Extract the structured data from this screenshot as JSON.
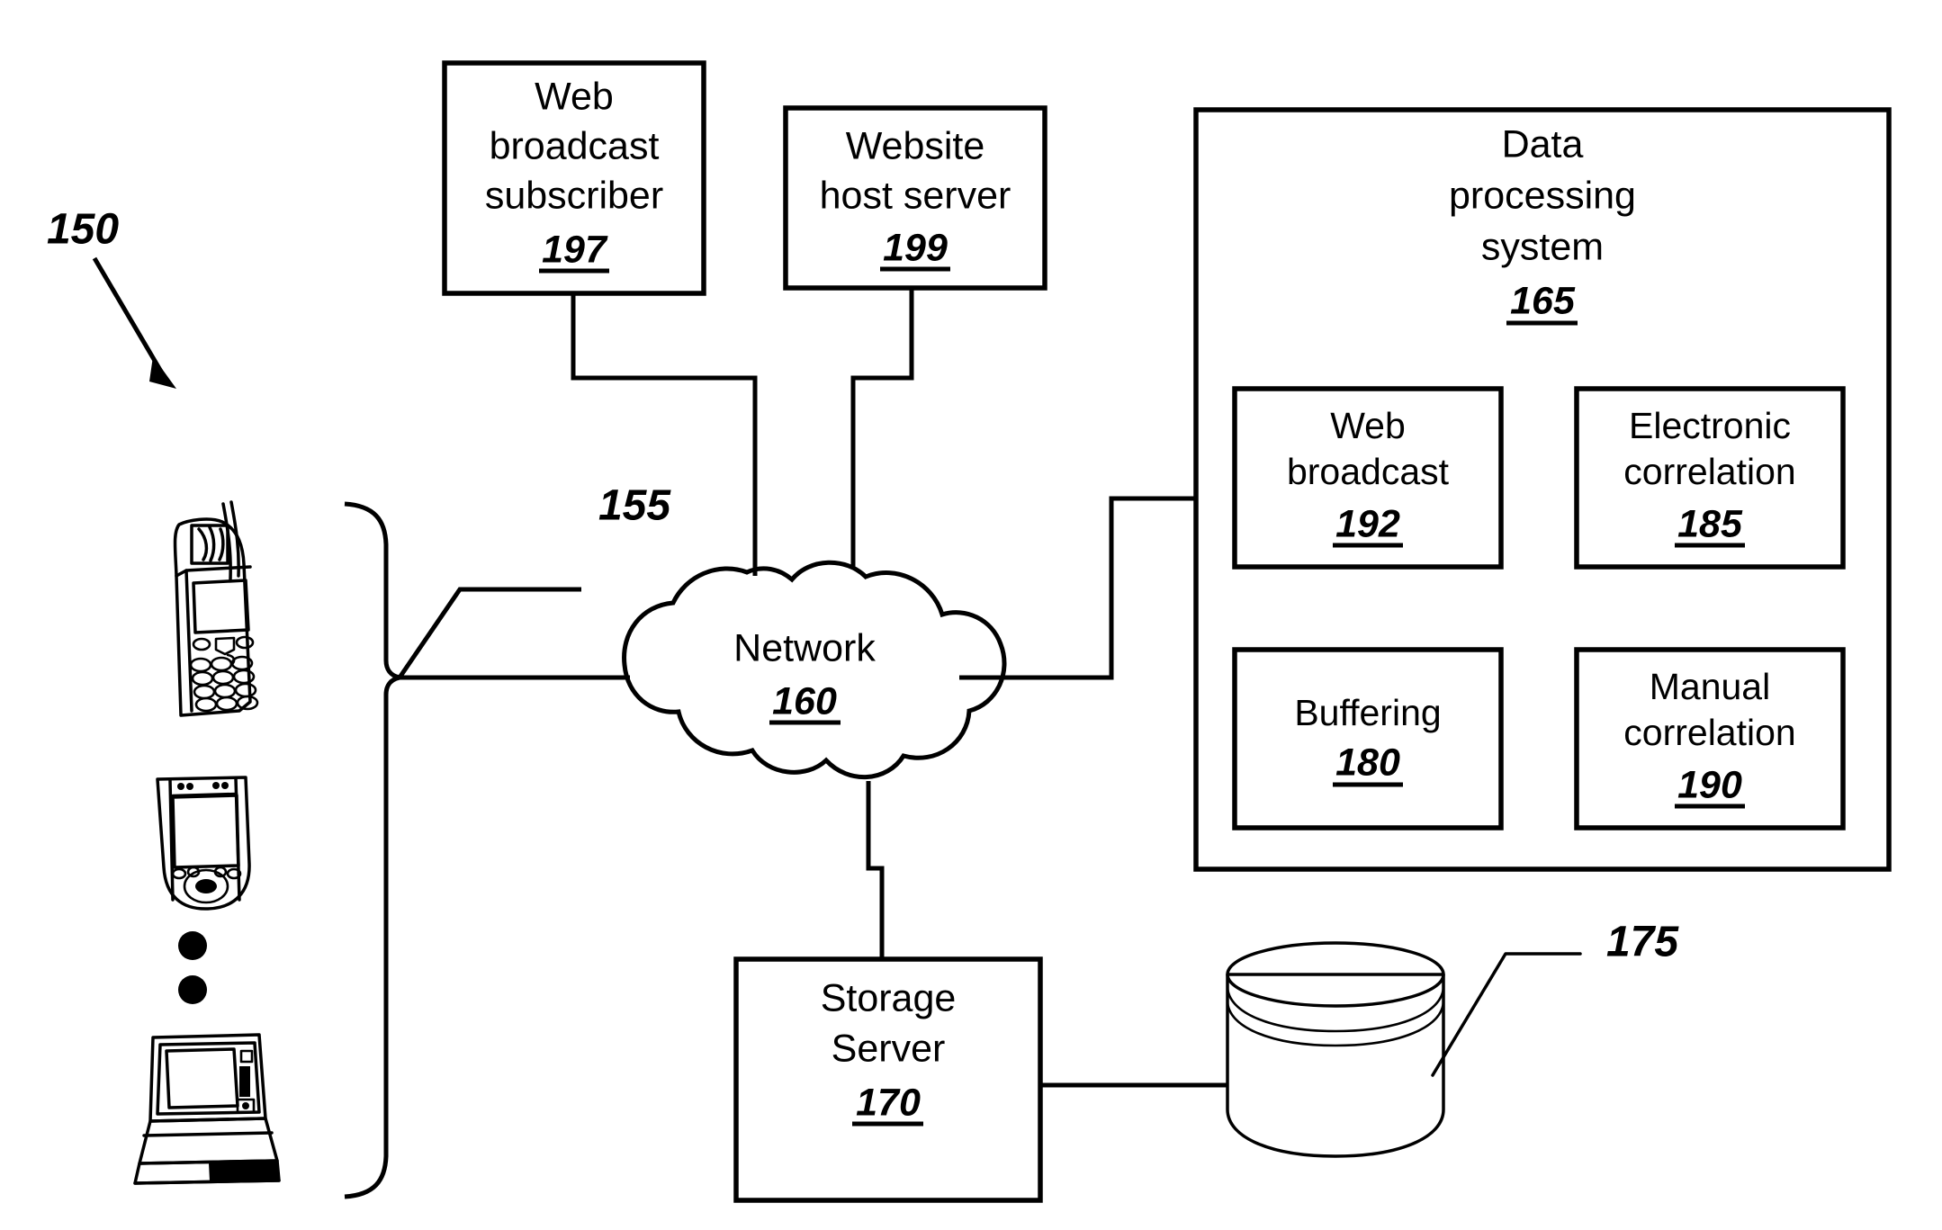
{
  "figure": {
    "title": "Network data processing system block diagram",
    "ink_color": "#000000",
    "background_color": "#ffffff"
  },
  "free_labels": [
    {
      "id": "system-ref",
      "text": "150",
      "name": "reference-numeral-150"
    },
    {
      "id": "clients-ref",
      "text": "155",
      "name": "reference-numeral-155"
    },
    {
      "id": "storage-unit-ref",
      "text": "175",
      "name": "reference-numeral-175"
    }
  ],
  "nodes": {
    "web_broadcast_subscriber": {
      "lines": [
        "Web",
        "broadcast",
        "subscriber"
      ],
      "ref": "197"
    },
    "website_host_server": {
      "lines": [
        "Website",
        "host server"
      ],
      "ref": "199"
    },
    "data_processing_system": {
      "lines": [
        "Data",
        "processing",
        "system"
      ],
      "ref": "165",
      "modules": [
        {
          "lines": [
            "Web",
            "broadcast"
          ],
          "ref": "192",
          "name": "module-web-broadcast"
        },
        {
          "lines": [
            "Electronic",
            "correlation"
          ],
          "ref": "185",
          "name": "module-electronic-correlation"
        },
        {
          "lines": [
            "Buffering"
          ],
          "ref": "180",
          "name": "module-buffering"
        },
        {
          "lines": [
            "Manual",
            "correlation"
          ],
          "ref": "190",
          "name": "module-manual-correlation"
        }
      ]
    },
    "network": {
      "lines": [
        "Network"
      ],
      "ref": "160"
    },
    "storage_server": {
      "lines": [
        "Storage",
        "Server"
      ],
      "ref": "170"
    },
    "storage_unit": {
      "lines": [],
      "ref": "175"
    }
  },
  "client_devices": [
    {
      "name": "mobile-phone-icon",
      "kind": "mobile phone"
    },
    {
      "name": "pda-icon",
      "kind": "personal digital assistant"
    },
    {
      "name": "vertical-ellipsis",
      "kind": "ellipsis dots"
    },
    {
      "name": "laptop-icon",
      "kind": "laptop computer"
    }
  ]
}
